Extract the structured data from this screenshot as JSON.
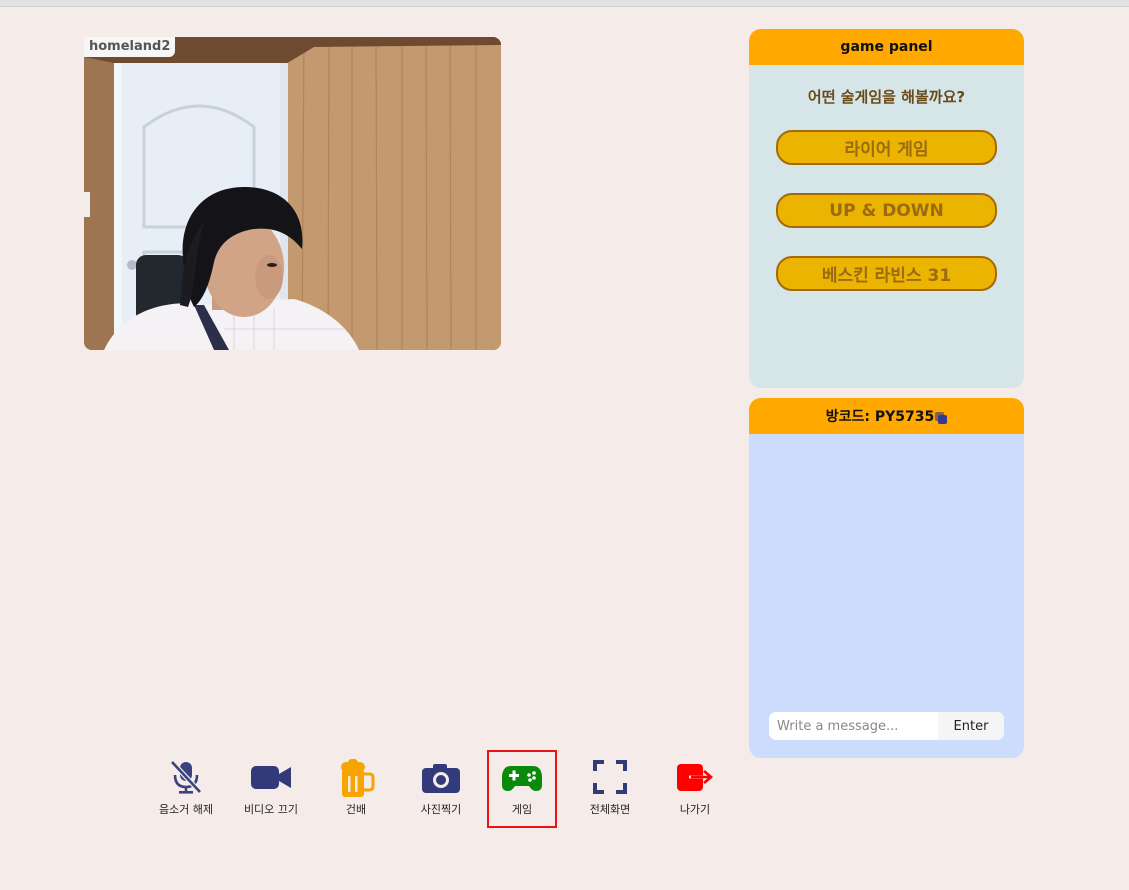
{
  "video": {
    "participant_name": "homeland2"
  },
  "game_panel": {
    "title": "game panel",
    "question": "어떤 술게임을 해볼까요?",
    "games": [
      "라이어 게임",
      "UP & DOWN",
      "베스킨 라빈스 31"
    ]
  },
  "chat": {
    "room_code_label": "방코드: PY5735",
    "placeholder": "Write a message...",
    "enter_label": "Enter"
  },
  "toolbar": {
    "items": [
      {
        "label": "음소거 해제",
        "icon": "mic-off-icon"
      },
      {
        "label": "비디오 끄기",
        "icon": "video-camera-icon"
      },
      {
        "label": "건배",
        "icon": "beer-mug-icon"
      },
      {
        "label": "사진찍기",
        "icon": "camera-icon"
      },
      {
        "label": "게임",
        "icon": "gamepad-icon"
      },
      {
        "label": "전체화면",
        "icon": "fullscreen-icon"
      },
      {
        "label": "나가기",
        "icon": "exit-icon"
      }
    ],
    "selected": "게임"
  },
  "colors": {
    "background": "#f5ece9",
    "accent": "#ffa800",
    "game_button": "#eab400",
    "game_panel_bg": "#d5e5e8",
    "chat_bg": "#ccdcfd",
    "icon_navy": "#323a7a",
    "game_icon": "#0a8a0a",
    "exit_icon": "#ff0000",
    "highlight": "#ee1111"
  }
}
